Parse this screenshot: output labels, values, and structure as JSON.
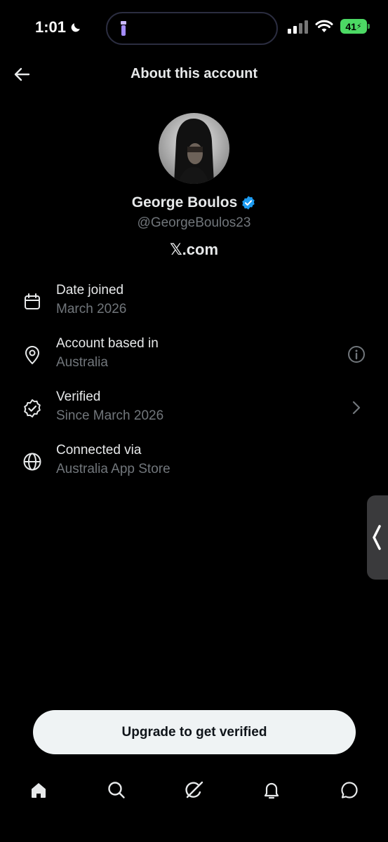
{
  "status_bar": {
    "time": "1:01",
    "battery": "41",
    "icons": [
      "moon-icon",
      "flashlight-icon",
      "signal-icon",
      "wifi-icon",
      "battery-charging-icon"
    ]
  },
  "header": {
    "title": "About this account",
    "back_icon": "arrow-left-icon"
  },
  "profile": {
    "name": "George Boulos",
    "handle": "@GeorgeBoulos23",
    "site": "𝕏.com",
    "verified_color": "#1d9bf0"
  },
  "info": [
    {
      "icon": "calendar-icon",
      "label": "Date joined",
      "value": "March 2026"
    },
    {
      "icon": "location-pin-icon",
      "label": "Account based in",
      "value": "Australia",
      "action_icon": "info-circle-icon"
    },
    {
      "icon": "verified-badge-icon",
      "label": "Verified",
      "value": "Since March 2026",
      "action_icon": "chevron-right-icon"
    },
    {
      "icon": "globe-icon",
      "label": "Connected via",
      "value": "Australia App Store"
    }
  ],
  "upgrade": {
    "label": "Upgrade to get verified"
  },
  "nav": [
    "home-icon",
    "search-icon",
    "grok-icon",
    "bell-icon",
    "chat-icon"
  ],
  "colors": {
    "background": "#000000",
    "text": "#e7e9ea",
    "muted": "#71767b",
    "accent": "#1d9bf0",
    "button_bg": "#eff3f4"
  }
}
